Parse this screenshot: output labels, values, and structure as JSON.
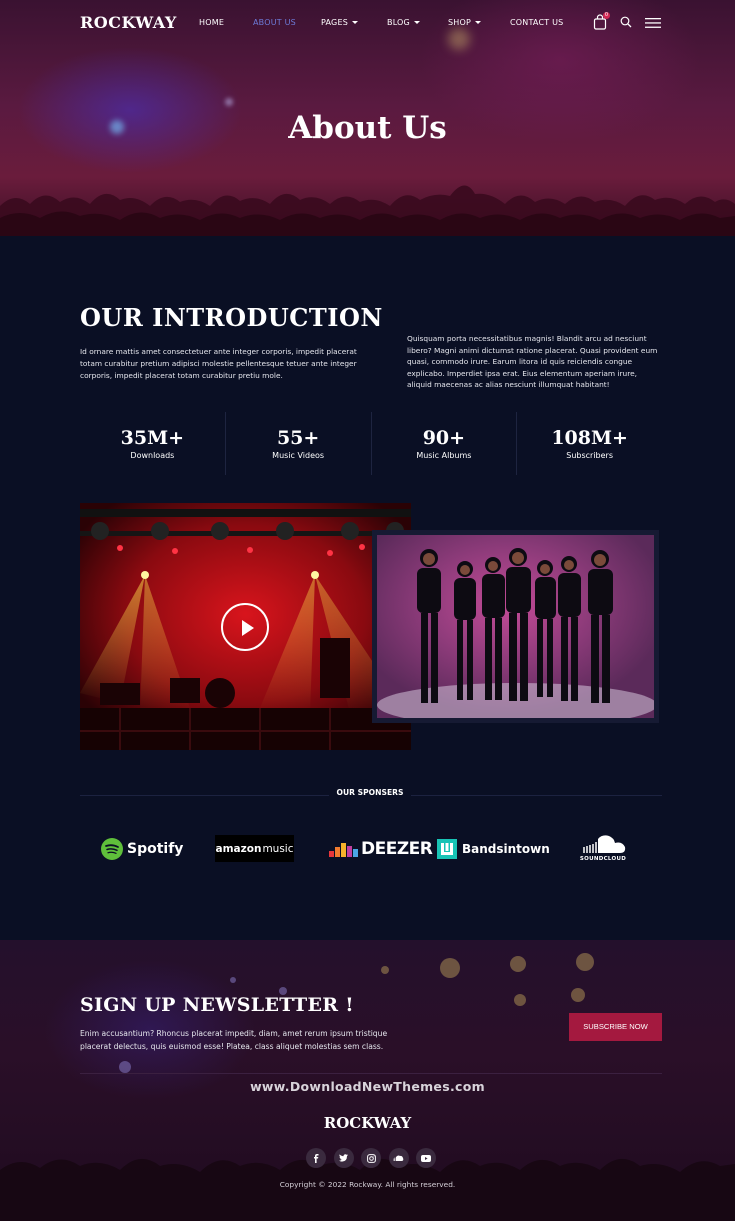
{
  "nav": {
    "logo": "ROCKWAY",
    "items": [
      {
        "label": "HOME",
        "dropdown": false
      },
      {
        "label": "ABOUT US",
        "dropdown": false,
        "active": true
      },
      {
        "label": "PAGES",
        "dropdown": true
      },
      {
        "label": "BLOG",
        "dropdown": true
      },
      {
        "label": "SHOP",
        "dropdown": true
      },
      {
        "label": "CONTACT US",
        "dropdown": false
      }
    ],
    "cart_count": "0",
    "icons": [
      "shopping-bag-icon",
      "search-icon",
      "hamburger-menu-icon"
    ]
  },
  "hero": {
    "title": "About Us"
  },
  "intro": {
    "title": "OUR INTRODUCTION",
    "left_text": "Id ornare mattis amet consectetuer ante integer corporis, impedit placerat totam curabitur pretium adipisci molestie pellentesque tetuer ante integer corporis, impedit placerat totam curabitur pretiu mole.",
    "right_text": "Quisquam porta necessitatibus magnis! Blandit arcu ad nesciunt libero? Magni animi dictumst ratione placerat. Quasi provident eum quasi, commodo irure. Earum litora id quis reiciendis congue explicabo. Imperdiet ipsa erat. Eius elementum aperiam irure, aliquid maecenas ac alias nesciunt illumquat habitant!"
  },
  "stats": [
    {
      "value": "35M+",
      "label": "Downloads"
    },
    {
      "value": "55+",
      "label": "Music Videos"
    },
    {
      "value": "90+",
      "label": "Music Albums"
    },
    {
      "value": "108M+",
      "label": "Subscribers"
    }
  ],
  "sponsors": {
    "heading": "OUR SPONSERS",
    "spotify": "Spotify",
    "amazon_a": "amazon",
    "amazon_b": "music",
    "deezer": "DEEZER",
    "bandsintown": "Bandsintown",
    "soundcloud": "SOUNDCLOUD"
  },
  "newsletter": {
    "title": "SIGN UP NEWSLETTER !",
    "text": "Enim accusantium? Rhoncus placerat impedit, diam, amet rerum ipsum tristique placerat delectus, quis euismod esse! Platea, class aliquet molestias sem class.",
    "button": "SUBSCRIBE NOW"
  },
  "footer": {
    "watermark": "www.DownloadNewThemes.com",
    "logo": "ROCKWAY",
    "socials": [
      "facebook-icon",
      "twitter-icon",
      "instagram-icon",
      "soundcloud-icon",
      "youtube-icon"
    ],
    "copyright": "Copyright © 2022 Rockway. All rights reserved."
  },
  "colors": {
    "background": "#0a0f24",
    "accent": "#a4193f",
    "active_nav": "#6d7bd8"
  }
}
